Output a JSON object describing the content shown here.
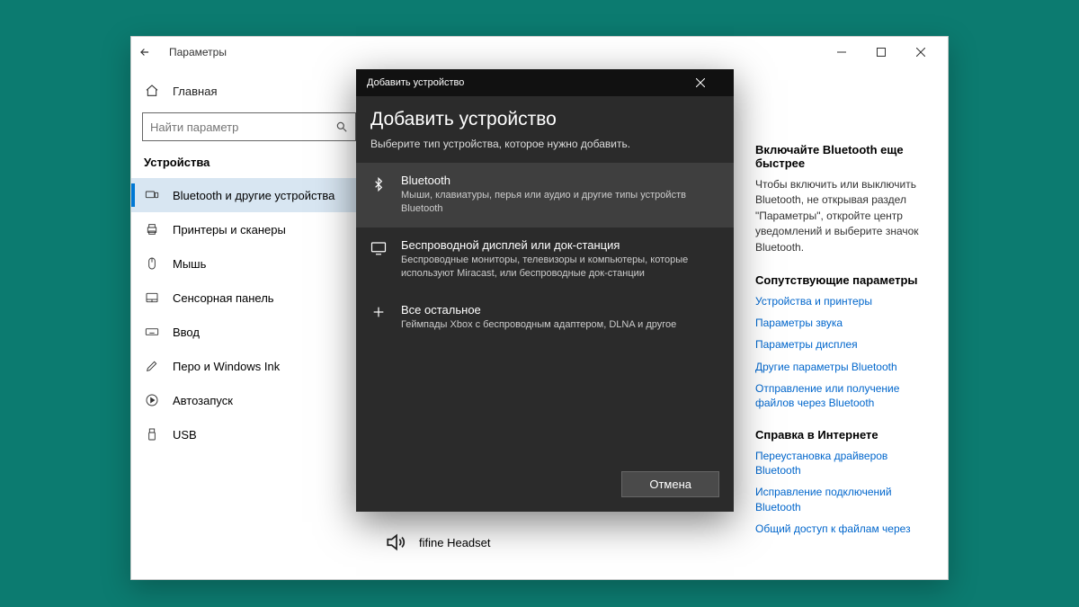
{
  "window": {
    "app_title": "Параметры",
    "controls": {
      "min": "—",
      "max": "☐",
      "close": "✕"
    }
  },
  "left": {
    "home_label": "Главная",
    "search_placeholder": "Найти параметр",
    "section_title": "Устройства",
    "items": [
      {
        "label": "Bluetooth и другие устройства",
        "icon": "keyboard"
      },
      {
        "label": "Принтеры и сканеры",
        "icon": "printer"
      },
      {
        "label": "Мышь",
        "icon": "mouse"
      },
      {
        "label": "Сенсорная панель",
        "icon": "touchpad"
      },
      {
        "label": "Ввод",
        "icon": "typing"
      },
      {
        "label": "Перо и Windows Ink",
        "icon": "pen"
      },
      {
        "label": "Автозапуск",
        "icon": "autoplay"
      },
      {
        "label": "USB",
        "icon": "usb"
      }
    ]
  },
  "right": {
    "tip_title": "Включайте Bluetooth еще быстрее",
    "tip_text": "Чтобы включить или выключить Bluetooth, не открывая раздел \"Параметры\", откройте центр уведомлений и выберите значок Bluetooth.",
    "related_title": "Сопутствующие параметры",
    "related_links": [
      "Устройства и принтеры",
      "Параметры звука",
      "Параметры дисплея",
      "Другие параметры Bluetooth",
      "Отправление или получение файлов через Bluetooth"
    ],
    "help_title": "Справка в Интернете",
    "help_links": [
      "Переустановка драйверов Bluetooth",
      "Исправление подключений Bluetooth",
      "Общий доступ к файлам через"
    ]
  },
  "device": {
    "name": "fifine Headset"
  },
  "dialog": {
    "titlebar": "Добавить устройство",
    "heading": "Добавить устройство",
    "subtitle": "Выберите тип устройства, которое нужно добавить.",
    "options": [
      {
        "title": "Bluetooth",
        "desc": "Мыши, клавиатуры, перья или аудио и другие типы устройств Bluetooth"
      },
      {
        "title": "Беспроводной дисплей или док-станция",
        "desc": "Беспроводные мониторы, телевизоры и компьютеры, которые используют Miracast, или беспроводные док-станции"
      },
      {
        "title": "Все остальное",
        "desc": "Геймпады Xbox с беспроводным адаптером, DLNA и другое"
      }
    ],
    "cancel_label": "Отмена"
  }
}
